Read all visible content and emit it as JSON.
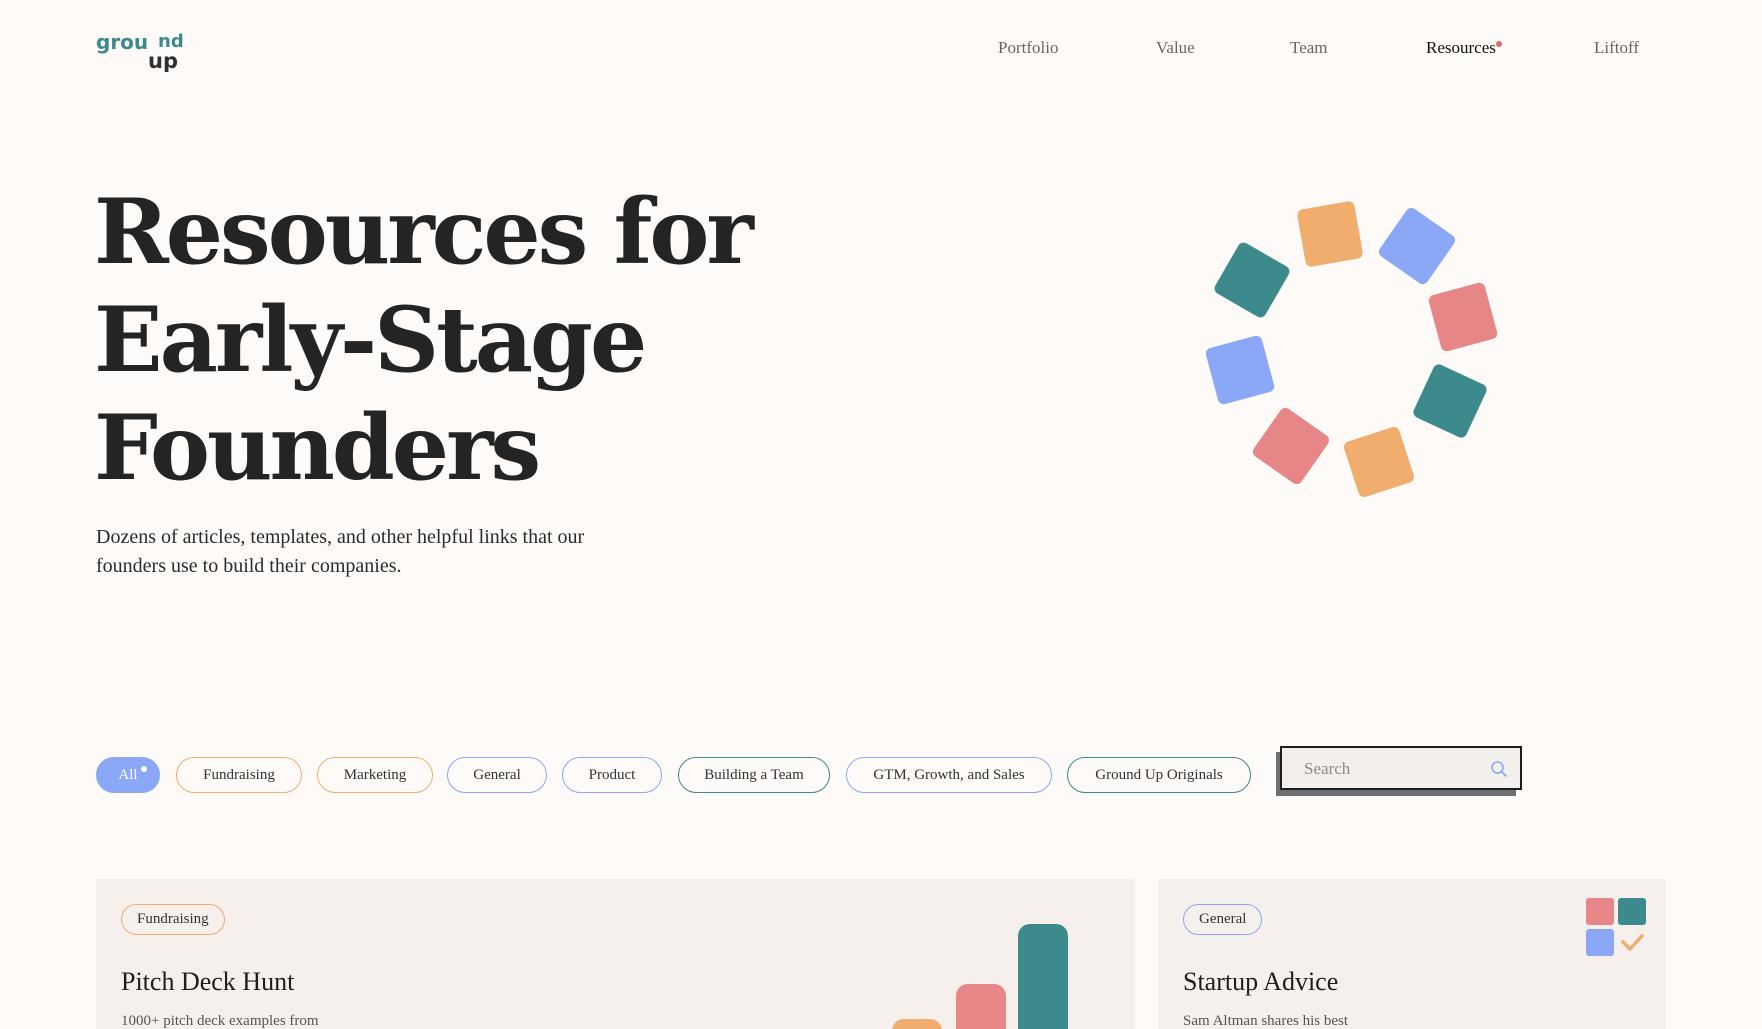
{
  "header": {
    "logo_text": "ground up",
    "nav": [
      {
        "label": "Portfolio",
        "active": false
      },
      {
        "label": "Value",
        "active": false
      },
      {
        "label": "Team",
        "active": false
      },
      {
        "label": "Resources",
        "active": true
      },
      {
        "label": "Liftoff",
        "active": false
      }
    ]
  },
  "hero": {
    "title_lines": [
      "Resources for",
      "Early-Stage",
      "Founders"
    ],
    "subtitle": "Dozens of articles, templates, and other helpful links that our founders use to build their companies."
  },
  "filters": {
    "chips": [
      {
        "label": "All",
        "active": true
      },
      {
        "label": "Fundraising",
        "active": false
      },
      {
        "label": "Marketing",
        "active": false
      },
      {
        "label": "General",
        "active": false
      },
      {
        "label": "Product",
        "active": false
      },
      {
        "label": "Building a Team",
        "active": false
      },
      {
        "label": "GTM, Growth, and Sales",
        "active": false
      },
      {
        "label": "Ground Up Originals",
        "active": false
      }
    ],
    "search": {
      "placeholder": "Search",
      "value": ""
    }
  },
  "cards": [
    {
      "tag": "Fundraising",
      "title": "Pitch Deck Hunt",
      "description": "1000+ pitch deck examples from"
    },
    {
      "tag": "General",
      "title": "Startup Advice",
      "description": "Sam Altman shares his best"
    }
  ],
  "colors": {
    "background": "#fdfaf7",
    "teal": "#3d8a8d",
    "orange": "#f0ad6e",
    "blue": "#8aa8f5",
    "pink": "#e68686",
    "card_background": "#f6f0ec"
  },
  "icons": {
    "search": "search-icon",
    "card_grid": "checklist-grid-icon"
  }
}
